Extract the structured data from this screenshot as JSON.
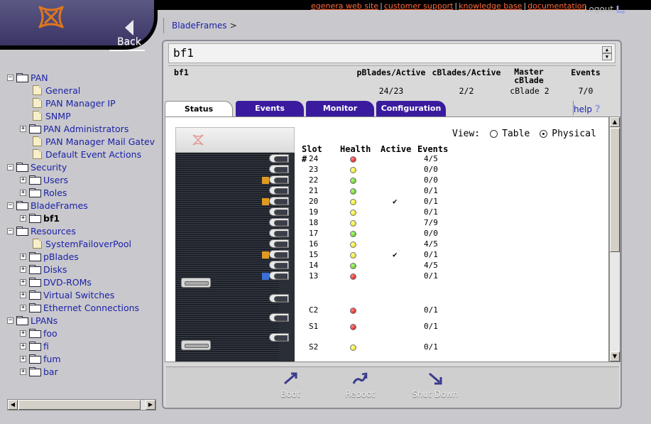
{
  "header": {
    "links": [
      "egenera web site",
      "customer support",
      "knowledge base",
      "documentation"
    ],
    "link_separator": "|",
    "logout_label": "Logout",
    "back_label": "Back"
  },
  "breadcrumb": {
    "item": "BladeFrames",
    "separator": ">"
  },
  "tree": [
    {
      "label": "PAN",
      "type": "folder",
      "level": 0,
      "exp": "−"
    },
    {
      "label": "General",
      "type": "doc",
      "level": 1
    },
    {
      "label": "PAN Manager IP",
      "type": "doc",
      "level": 1
    },
    {
      "label": "SNMP",
      "type": "doc",
      "level": 1
    },
    {
      "label": "PAN Administrators",
      "type": "folder",
      "level": 1,
      "exp": "+"
    },
    {
      "label": "PAN Manager Mail Gatev",
      "type": "doc",
      "level": 1
    },
    {
      "label": "Default Event Actions",
      "type": "doc",
      "level": 1
    },
    {
      "label": "Security",
      "type": "folder",
      "level": 0,
      "exp": "−"
    },
    {
      "label": "Users",
      "type": "folder",
      "level": 1,
      "exp": "+"
    },
    {
      "label": "Roles",
      "type": "folder",
      "level": 1,
      "exp": "+"
    },
    {
      "label": "BladeFrames",
      "type": "folder",
      "level": 0,
      "exp": "−"
    },
    {
      "label": "bf1",
      "type": "folder",
      "level": 1,
      "exp": "+",
      "bold": true
    },
    {
      "label": "Resources",
      "type": "folder",
      "level": 0,
      "exp": "−"
    },
    {
      "label": "SystemFailoverPool",
      "type": "doc",
      "level": 1
    },
    {
      "label": "pBlades",
      "type": "folder",
      "level": 1,
      "exp": "+"
    },
    {
      "label": "Disks",
      "type": "folder",
      "level": 1,
      "exp": "+"
    },
    {
      "label": "DVD-ROMs",
      "type": "folder",
      "level": 1,
      "exp": "+"
    },
    {
      "label": "Virtual Switches",
      "type": "folder",
      "level": 1,
      "exp": "+"
    },
    {
      "label": "Ethernet Connections",
      "type": "folder",
      "level": 1,
      "exp": "+"
    },
    {
      "label": "LPANs",
      "type": "folder",
      "level": 0,
      "exp": "−"
    },
    {
      "label": "foo",
      "type": "folder",
      "level": 1,
      "exp": "+"
    },
    {
      "label": "fi",
      "type": "folder",
      "level": 1,
      "exp": "+"
    },
    {
      "label": "fum",
      "type": "folder",
      "level": 1,
      "exp": "+"
    },
    {
      "label": "bar",
      "type": "folder",
      "level": 1,
      "exp": "+"
    }
  ],
  "panel": {
    "title": "bf1",
    "summary": {
      "name": "bf1",
      "headers": [
        "pBlades/Active",
        "cBlades/Active",
        "Master cBlade",
        "Events"
      ],
      "values": [
        "24/23",
        "2/2",
        "cBlade 2",
        "7/0"
      ]
    },
    "tabs": [
      "Status",
      "Events",
      "Monitor",
      "Configuration"
    ],
    "active_tab": "Status",
    "help_label": "help",
    "help_icon": "?",
    "view_label": "View:",
    "view_options": [
      "Table",
      "Physical"
    ],
    "view_selected": "Physical",
    "slot_headers": [
      "Slot #",
      "Health",
      "Active",
      "Events"
    ],
    "slots": [
      {
        "slot": "24",
        "health": "red",
        "active": "",
        "events": "4/5"
      },
      {
        "slot": "23",
        "health": "yellow",
        "active": "",
        "events": "0/0"
      },
      {
        "slot": "22",
        "health": "green",
        "active": "",
        "events": "0/0"
      },
      {
        "slot": "21",
        "health": "green",
        "active": "",
        "events": "0/1"
      },
      {
        "slot": "20",
        "health": "yellow",
        "active": "✔",
        "events": "0/1"
      },
      {
        "slot": "19",
        "health": "yellow",
        "active": "",
        "events": "0/1"
      },
      {
        "slot": "18",
        "health": "yellow",
        "active": "",
        "events": "7/9"
      },
      {
        "slot": "17",
        "health": "green",
        "active": "",
        "events": "0/0"
      },
      {
        "slot": "16",
        "health": "yellow",
        "active": "",
        "events": "4/5"
      },
      {
        "slot": "15",
        "health": "yellow",
        "active": "✔",
        "events": "0/1"
      },
      {
        "slot": "14",
        "health": "green",
        "active": "",
        "events": "4/5"
      },
      {
        "slot": "13",
        "health": "red",
        "active": "",
        "events": "0/1"
      },
      {
        "slot": "C2",
        "health": "red",
        "active": "",
        "events": "0/1"
      },
      {
        "slot": "S1",
        "health": "red",
        "active": "",
        "events": "0/1"
      },
      {
        "slot": "S2",
        "health": "yellow",
        "active": "",
        "events": "0/1"
      }
    ],
    "actions": [
      "Boot",
      "Reboot",
      "Shut Down"
    ]
  },
  "colors": {
    "link_orange": "#ff6a3c",
    "link_blue": "#1a22a8",
    "tab_purple": "#3a1b9e",
    "frame_grey": "#c9c8cc",
    "header_purple": "#4a4575"
  }
}
